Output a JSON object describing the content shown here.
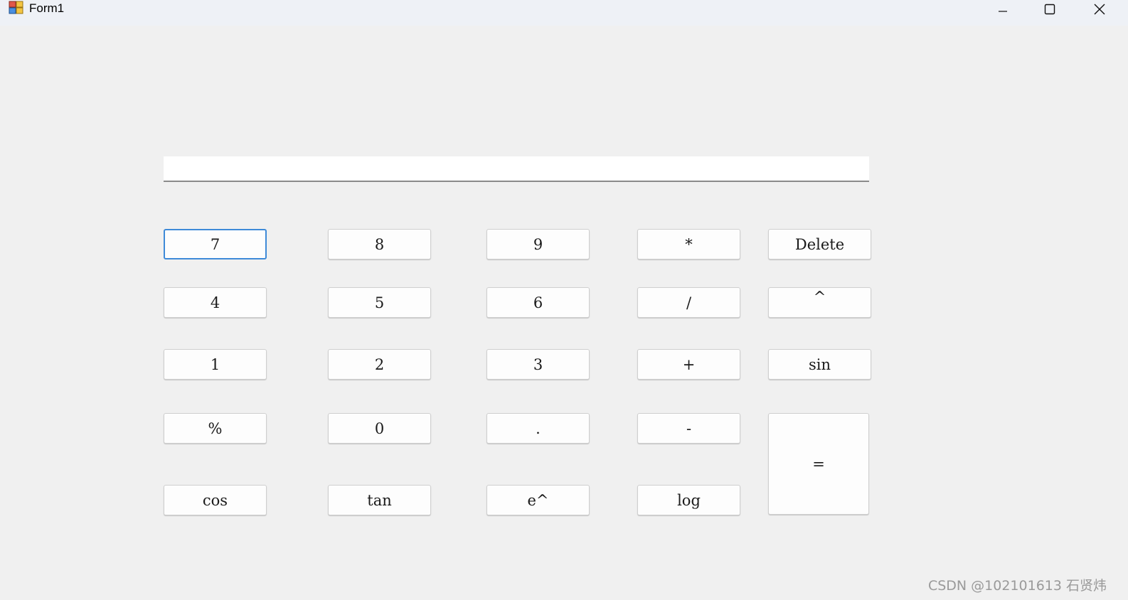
{
  "window": {
    "title": "Form1"
  },
  "display": {
    "value": ""
  },
  "buttons": {
    "seven": "7",
    "eight": "8",
    "nine": "9",
    "multiply": "*",
    "delete": "Delete",
    "four": "4",
    "five": "5",
    "six": "6",
    "divide": "/",
    "power": "^",
    "one": "1",
    "two": "2",
    "three": "3",
    "plus": "+",
    "sin": "sin",
    "percent": "%",
    "zero": "0",
    "dot": ".",
    "minus": "-",
    "equals": "=",
    "cos": "cos",
    "tan": "tan",
    "exp": "e^",
    "log": "log"
  },
  "watermark": "CSDN @102101613 石贤炜",
  "icons": {
    "app": "app-form-icon",
    "minimize": "minimize-icon",
    "maximize": "maximize-icon",
    "close": "close-icon"
  },
  "colors": {
    "focus_border": "#3e8ad8",
    "background": "#f0f0f0",
    "titlebar": "#eef1f6"
  }
}
